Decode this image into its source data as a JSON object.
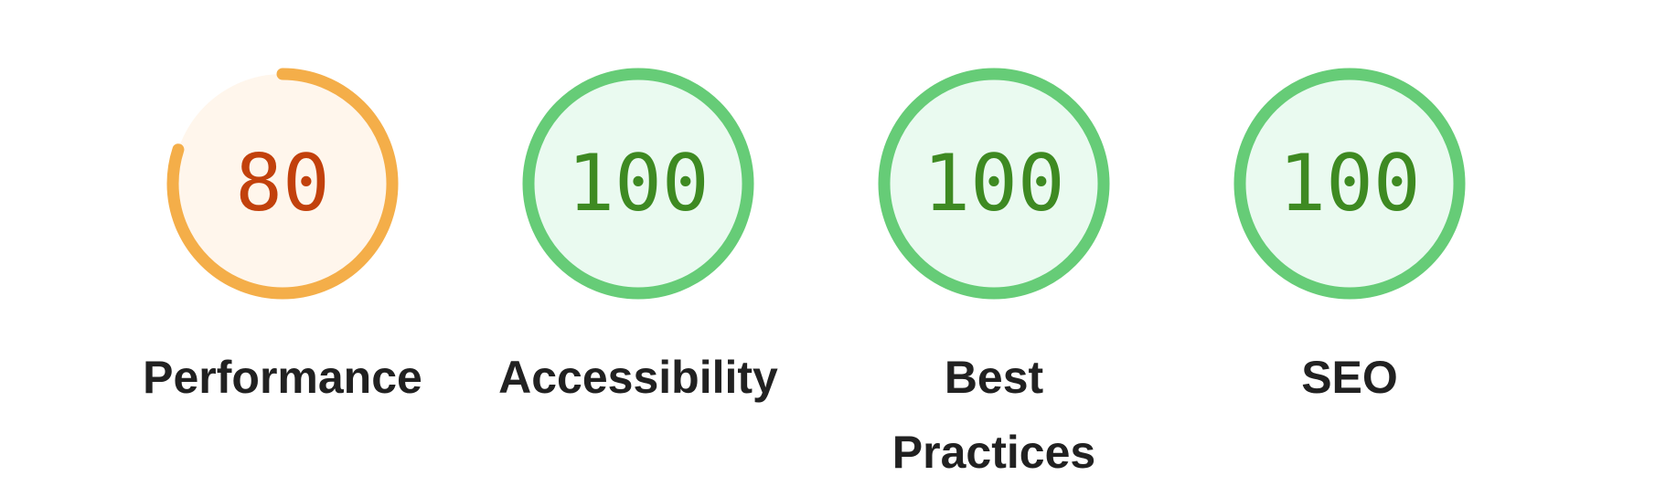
{
  "colors": {
    "fail_arc": "#f4ae49",
    "fail_fill": "#fff6ec",
    "fail_text": "#c2410c",
    "pass_arc": "#66cc77",
    "pass_fill": "#eafaf0",
    "pass_text": "#3e8a22",
    "label_text": "#212121"
  },
  "gauges": [
    {
      "label": "Performance",
      "score": "80",
      "fraction": 0.8,
      "rating": "average"
    },
    {
      "label": "Accessibility",
      "score": "100",
      "fraction": 1.0,
      "rating": "pass"
    },
    {
      "label": "Best Practices",
      "score": "100",
      "fraction": 1.0,
      "rating": "pass"
    },
    {
      "label": "SEO",
      "score": "100",
      "fraction": 1.0,
      "rating": "pass"
    }
  ]
}
